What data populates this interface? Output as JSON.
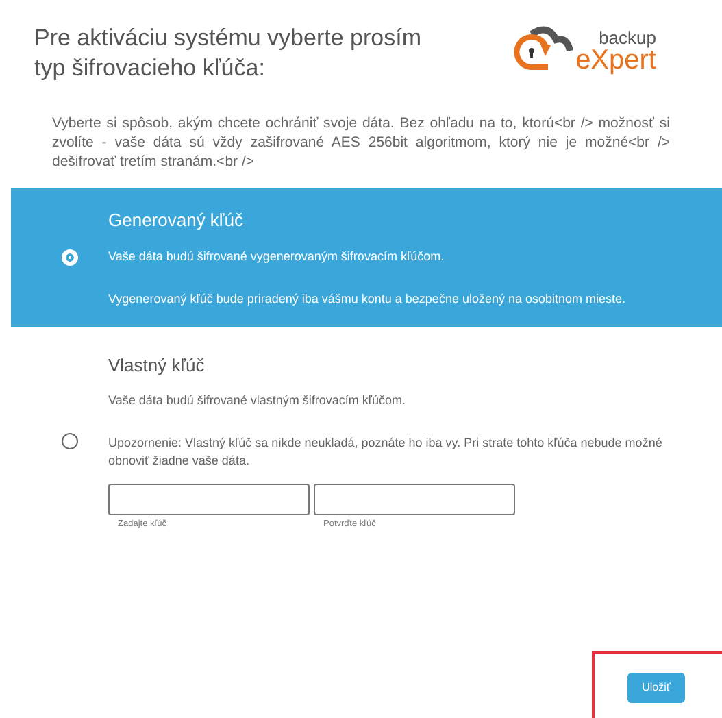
{
  "header": {
    "title": "Pre aktiváciu systému vyberte prosím typ šifrovacieho kľúča:",
    "logo": {
      "top": "backup",
      "bottom": "eXpert"
    }
  },
  "intro": "Vyberte si spôsob, akým chcete ochrániť svoje dáta. Bez ohľadu na to, ktorú<br /> možnosť si zvolíte - vaše dáta sú vždy zašifrované AES 256bit algoritmom, ktorý nie je možné<br /> dešifrovať tretím stranám.<br />",
  "options": [
    {
      "title": "Generovaný kľúč",
      "selected": true,
      "lines": [
        "Vaše dáta budú šifrované vygenerovaným šifrovacím kľúčom.",
        "Vygenerovaný kľúč bude priradený iba vášmu kontu a bezpečne uložený na osobitnom mieste."
      ]
    },
    {
      "title": "Vlastný kľúč",
      "selected": false,
      "lines": [
        "Vaše dáta budú šifrované vlastným šifrovacím kľúčom.",
        "Upozornenie: Vlastný kľúč sa nikde neukladá, poznáte ho iba vy. Pri strate tohto kľúča nebude možné",
        "obnoviť žiadne vaše dáta."
      ],
      "fields": [
        {
          "label": "Zadajte kľúč"
        },
        {
          "label": "Potvrďte kľúč"
        }
      ]
    }
  ],
  "save_button": "Uložiť"
}
